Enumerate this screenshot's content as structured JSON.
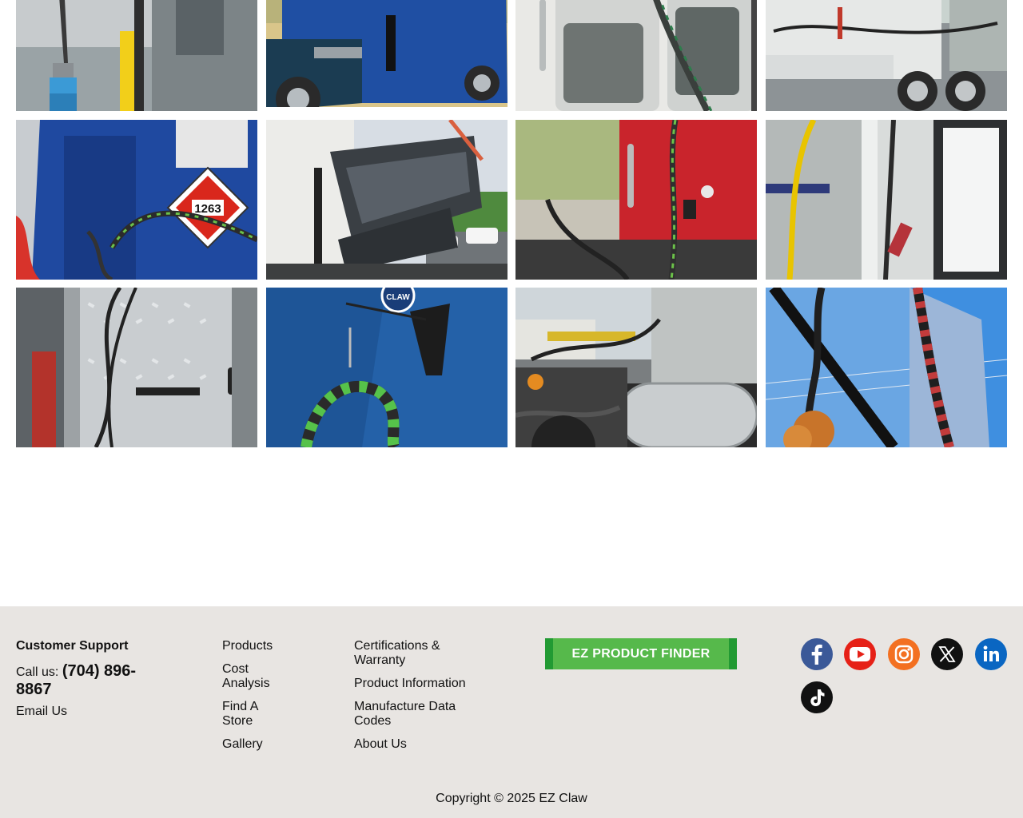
{
  "gallery": {
    "items": [
      {
        "alt": "blue air hose coupling"
      },
      {
        "alt": "blue semi truck side"
      },
      {
        "alt": "white cab with coiled line"
      },
      {
        "alt": "white truck rear axle"
      },
      {
        "alt": "blue cab with hazmat placard"
      },
      {
        "alt": "tilted tire rack on trailer"
      },
      {
        "alt": "red cab with gladhands"
      },
      {
        "alt": "yellow line on white truck"
      },
      {
        "alt": "diamond plate with lines"
      },
      {
        "alt": "blue cab with coiled hose"
      },
      {
        "alt": "fuel tank and hoses"
      },
      {
        "alt": "lines against blue sky"
      }
    ],
    "hazmat_number": "1263",
    "tag_text": "CLAW"
  },
  "footer": {
    "customer_support": {
      "title": "Customer Support",
      "call_prefix": "Call us:",
      "phone_line1": "(704) 896-",
      "phone_line2": "8867",
      "email": "Email Us"
    },
    "nav1": [
      "Products",
      "Cost Analysis",
      "Find A Store",
      "Gallery"
    ],
    "nav1_lines": [
      [
        "Products"
      ],
      [
        "Cost",
        "Analysis"
      ],
      [
        "Find A",
        "Store"
      ],
      [
        "Gallery"
      ]
    ],
    "nav2_lines": [
      [
        "Certifications &",
        "Warranty"
      ],
      [
        "Product Information"
      ],
      [
        "Manufacture Data",
        "Codes"
      ],
      [
        "About Us"
      ]
    ],
    "finder_label": "EZ PRODUCT FINDER",
    "social": [
      "facebook-icon",
      "youtube-icon",
      "instagram-icon",
      "x-icon",
      "linkedin-icon",
      "tiktok-icon"
    ],
    "copyright": "Copyright © 2025 EZ Claw"
  },
  "colors": {
    "footer_bg": "#e8e5e2",
    "phone": "#0d3f86",
    "finder_bg": "#56b94b",
    "finder_edge": "#229a33"
  }
}
